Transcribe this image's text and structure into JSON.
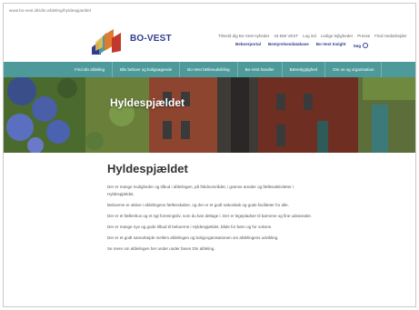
{
  "browser": {
    "address": "www.bo-vest.dk/din-afdeling/hyldespjaeldet"
  },
  "brand": {
    "name": "BO-VEST"
  },
  "utility_links": [
    "Tilmeld dig Bo-Vest-nyheder",
    "43 666 VEST",
    "Log ind",
    "Ledige lejligheder",
    "Presse",
    "Find medarbejder"
  ],
  "utility_links2": [
    "Beboerportal",
    "Bestyrelsesdatabase",
    "Bo-Vest Insight",
    "Søg"
  ],
  "nav": [
    "Find din afdeling",
    "Bliv beboer og boligsøgende",
    "Bo-Vest fællesudvikling",
    "Bo-Vest handler",
    "Bæredygtighed",
    "Om os og organisation"
  ],
  "hero": {
    "title": "Hyldespjældet"
  },
  "page": {
    "title": "Hyldespjældet",
    "paragraphs": [
      "Der er mange muligheder og tilbud i afdelingen, på fritidsområdet, i grønne arealer og fællesaktiviteter i Hyldespjældet.",
      "Beboerne er aktive i afdelingens fællesskaber, og der er et godt naboskab og gode faciliteter for alle.",
      "Der er et fælleshus og et rigt foreningsliv, som du kan deltage i. Der er legepladser til børnene og fine udearealer.",
      "Der er mange nye og gode tilbud til beboerne i Hyldespjældet, både for børn og for voksne.",
      "Der er et godt samarbejde mellem afdelingen og boligorganisationen om afdelingens udvikling.",
      "Se mere om afdelingen her under under fanen Din afdeling."
    ]
  },
  "colors": {
    "nav_bg": "#4e9a9a",
    "brand": "#2f3e8f",
    "brick": "#8a3e2a"
  }
}
